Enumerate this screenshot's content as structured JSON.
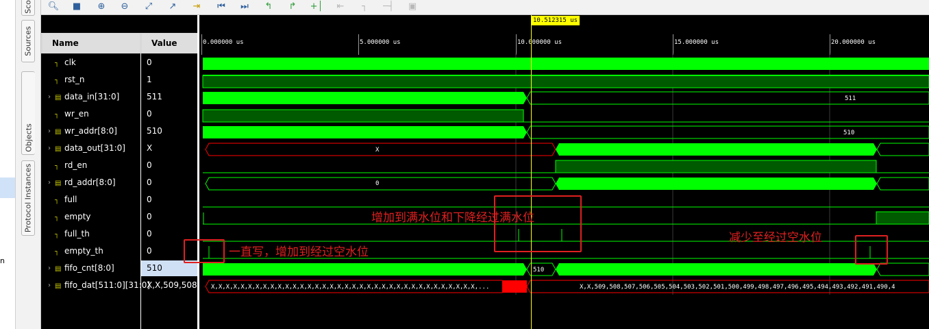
{
  "side_tabs": [
    "Sco",
    "Sources",
    "Objects",
    "Protocol Instances"
  ],
  "left_fragment": "n",
  "columns": {
    "name": "Name",
    "value": "Value"
  },
  "cursor_label": "10.512315 us",
  "time_ticks": [
    "0.000000 us",
    "5.000000 us",
    "10.000000 us",
    "15.000000 us",
    "20.000000 us"
  ],
  "signals": [
    {
      "name": "clk",
      "value": "0",
      "bus": false
    },
    {
      "name": "rst_n",
      "value": "1",
      "bus": false
    },
    {
      "name": "data_in[31:0]",
      "value": "511",
      "bus": true
    },
    {
      "name": "wr_en",
      "value": "0",
      "bus": false
    },
    {
      "name": "wr_addr[8:0]",
      "value": "510",
      "bus": true
    },
    {
      "name": "data_out[31:0]",
      "value": "X",
      "bus": true
    },
    {
      "name": "rd_en",
      "value": "0",
      "bus": false
    },
    {
      "name": "rd_addr[8:0]",
      "value": "0",
      "bus": true
    },
    {
      "name": "full",
      "value": "0",
      "bus": false
    },
    {
      "name": "empty",
      "value": "0",
      "bus": false
    },
    {
      "name": "full_th",
      "value": "0",
      "bus": false
    },
    {
      "name": "empty_th",
      "value": "0",
      "bus": false
    },
    {
      "name": "fifo_cnt[8:0]",
      "value": "510",
      "bus": true
    },
    {
      "name": "fifo_dat[511:0][31:0]",
      "value": "X,X,509,508,507",
      "bus": true
    }
  ],
  "wave_labels": {
    "data_in_right": "511",
    "wr_addr_right": "510",
    "data_out_left": "X",
    "rd_addr_left": "0",
    "fifo_cnt_mid": "510",
    "fifo_dat_left": "X,X,X,X,X,X,X,X,X,X,X,X,X,X,X,X,X,X,X,X,X,X,X,X,X,X,X,X,X,X,X,X,X,X,X,X,...",
    "fifo_dat_right": "X,X,509,508,507,506,505,504,503,502,501,500,499,498,497,496,495,494,493,492,491,490,4"
  },
  "annotations": {
    "write_empty": "一直写，增加到经过空水位",
    "full_level": "增加到满水位和下降经过满水位",
    "read_empty": "减少至经过空水位"
  },
  "colors": {
    "wave": "#00ff00",
    "x_state": "#ff0000",
    "cursor": "#ffff00",
    "annotation": "#e02020"
  },
  "toolbar_icons": [
    "zoom-search-icon",
    "save-icon",
    "zoom-in-icon",
    "zoom-out-icon",
    "zoom-fit-icon",
    "cursor-icon",
    "marker-icon",
    "go-start-icon",
    "go-end-icon",
    "prev-transition-icon",
    "next-transition-icon",
    "add-marker-icon",
    "prev-marker-icon",
    "next-marker-icon",
    "swap-cursor-icon",
    "snap-icon"
  ]
}
